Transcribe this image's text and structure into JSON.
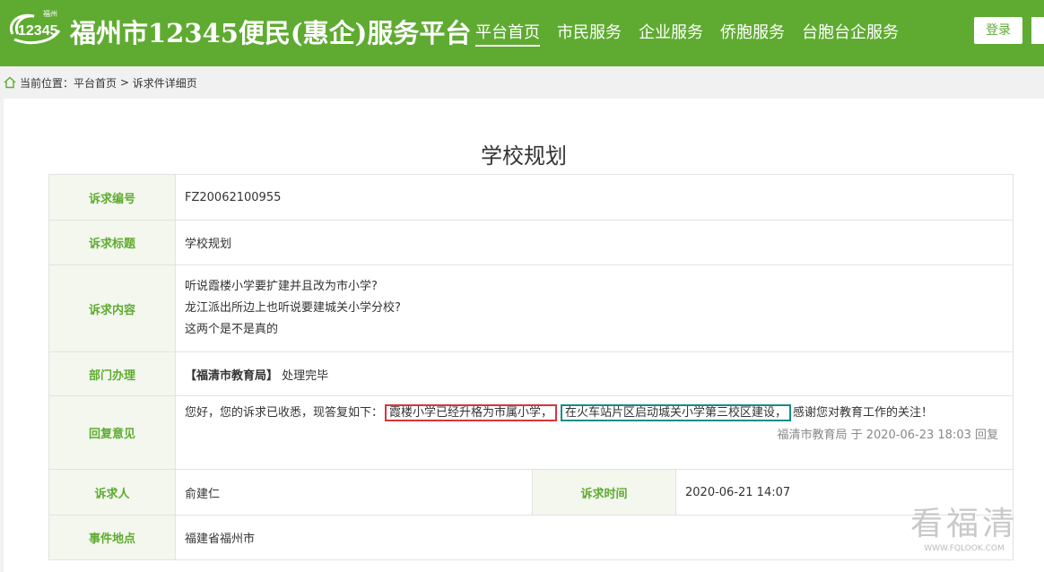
{
  "header": {
    "logo_text": "12345",
    "logo_sub": "福州",
    "title": "福州市12345便民(惠企)服务平台",
    "nav": [
      {
        "label": "平台首页",
        "active": true
      },
      {
        "label": "市民服务",
        "active": false
      },
      {
        "label": "企业服务",
        "active": false
      },
      {
        "label": "侨胞服务",
        "active": false
      },
      {
        "label": "台胞台企服务",
        "active": false
      }
    ],
    "login_label": "登录"
  },
  "breadcrumb": {
    "prefix": "当前位置：",
    "home": "平台首页",
    "separator": " > ",
    "current": "诉求件详细页"
  },
  "page_title": "学校规划",
  "detail": {
    "number_label": "诉求编号",
    "number_value": "FZ20062100955",
    "subject_label": "诉求标题",
    "subject_value": "学校规划",
    "content_label": "诉求内容",
    "content_lines": [
      "听说霞楼小学要扩建并且改为市小学?",
      "龙江派出所边上也听说要建城关小学分校?",
      "这两个是不是真的"
    ],
    "dept_label": "部门办理",
    "dept_name": "【福清市教育局】",
    "dept_status": "处理完毕",
    "reply_label": "回复意见",
    "reply_prefix": "您好，您的诉求已收悉，现答复如下：",
    "reply_highlight1": "霞楼小学已经升格为市属小学，",
    "reply_highlight2": "在火车站片区启动城关小学第三校区建设，",
    "reply_suffix": "感谢您对教育工作的关注！",
    "reply_meta": "福清市教育局 于 2020-06-23 18:03 回复",
    "person_label": "诉求人",
    "person_value": "俞建仁",
    "time_label": "诉求时间",
    "time_value": "2020-06-21 14:07",
    "location_label": "事件地点",
    "location_value": "福建省福州市"
  },
  "watermark": {
    "text": "看福清",
    "url": "WWW.FQLOOK.COM"
  },
  "colors": {
    "brand_green": "#5fab31",
    "highlight_red": "#d9343c",
    "highlight_teal": "#138d8a"
  }
}
